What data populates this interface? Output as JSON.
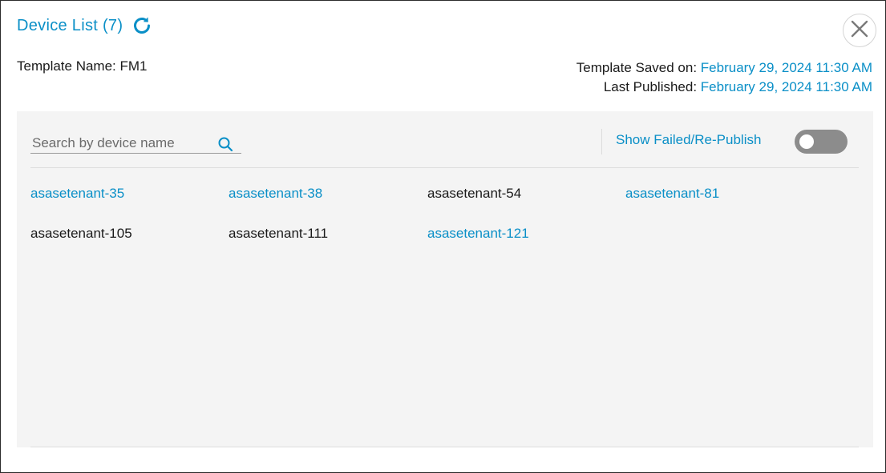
{
  "header": {
    "title": "Device List (7)"
  },
  "template": {
    "name_text": "Template Name: FM1"
  },
  "meta": {
    "saved_label": "Template Saved on: ",
    "saved_value": "February 29, 2024 11:30 AM",
    "published_label": "Last Published: ",
    "published_value": "February 29, 2024 11:30 AM"
  },
  "search": {
    "placeholder": "Search by device name",
    "value": ""
  },
  "toggle": {
    "label": "Show Failed/Re-Publish",
    "on": false
  },
  "devices": [
    {
      "name": "asasetenant-35",
      "link": true
    },
    {
      "name": "asasetenant-38",
      "link": true
    },
    {
      "name": "asasetenant-54",
      "link": false
    },
    {
      "name": "asasetenant-81",
      "link": true
    },
    {
      "name": "asasetenant-105",
      "link": false
    },
    {
      "name": "asasetenant-111",
      "link": false
    },
    {
      "name": "asasetenant-121",
      "link": true
    }
  ],
  "colors": {
    "accent": "#0a8fc7",
    "panel_bg": "#f4f4f4",
    "toggle_off": "#8c8c8c"
  },
  "icons": {
    "refresh": "refresh-icon",
    "close": "close-icon",
    "search": "search-icon"
  }
}
